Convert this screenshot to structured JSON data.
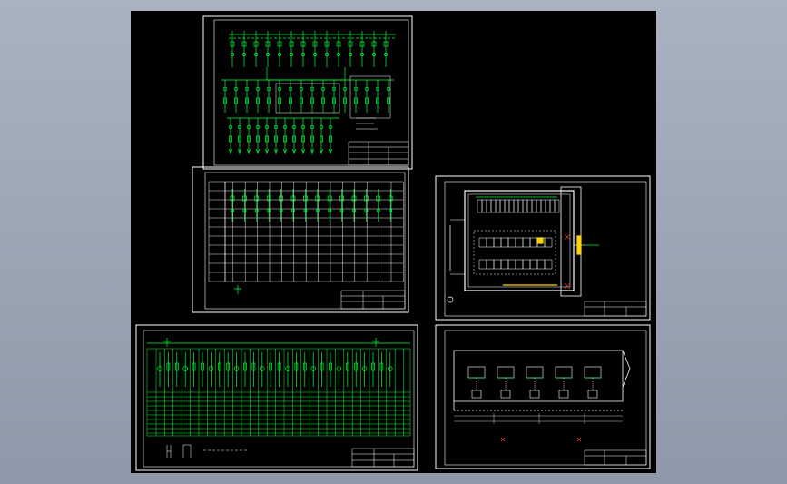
{
  "viewer": {
    "background_colors": [
      "#a9b2c0",
      "#8e98a8"
    ],
    "canvas_color": "#000000"
  },
  "drawing": {
    "sheet_count": 5,
    "line_colors": {
      "frame": "#ffffff",
      "circuit": "#00ff3c",
      "plan": "#ffffff",
      "highlight": "#ffd400",
      "annotation": "#ff4040"
    },
    "sheets": [
      {
        "name": "main-wiring-diagram",
        "kind": "schematic"
      },
      {
        "name": "switchgear-schedule",
        "kind": "table-schematic"
      },
      {
        "name": "substation-floor-plan",
        "kind": "plan"
      },
      {
        "name": "panel-elevation-schedule",
        "kind": "table-schematic"
      },
      {
        "name": "equipment-layout-section",
        "kind": "section"
      }
    ]
  }
}
